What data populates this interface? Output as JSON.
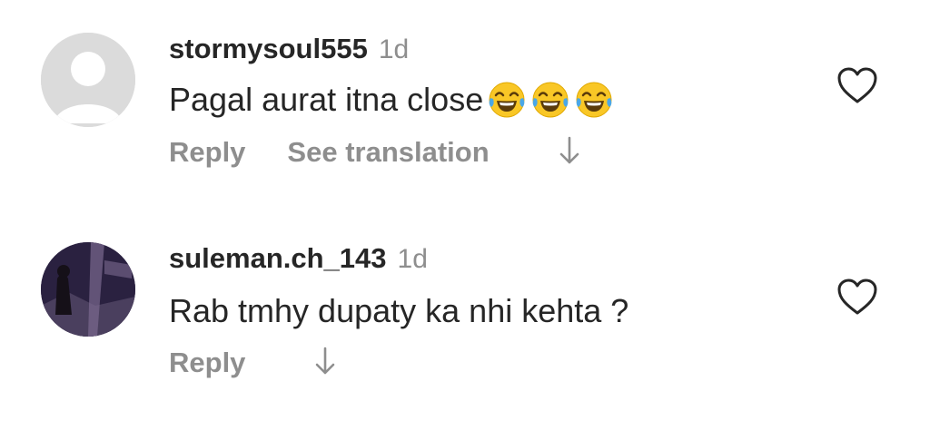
{
  "comments": [
    {
      "username": "stormysoul555",
      "time": "1d",
      "text": "Pagal aurat itna close",
      "emoji_count": 3,
      "emoji_icon": "face-with-tears-of-joy-icon",
      "reply_label": "Reply",
      "translation_label": "See translation",
      "liked": false
    },
    {
      "username": "suleman.ch_143",
      "time": "1d",
      "text": "Rab tmhy dupaty ka nhi kehta ?",
      "reply_label": "Reply",
      "liked": false
    }
  ],
  "colors": {
    "primary_text": "#262626",
    "secondary_text": "#8e8e8e",
    "avatar_placeholder": "#dbdbdb",
    "emoji_face": "#f9c726"
  }
}
